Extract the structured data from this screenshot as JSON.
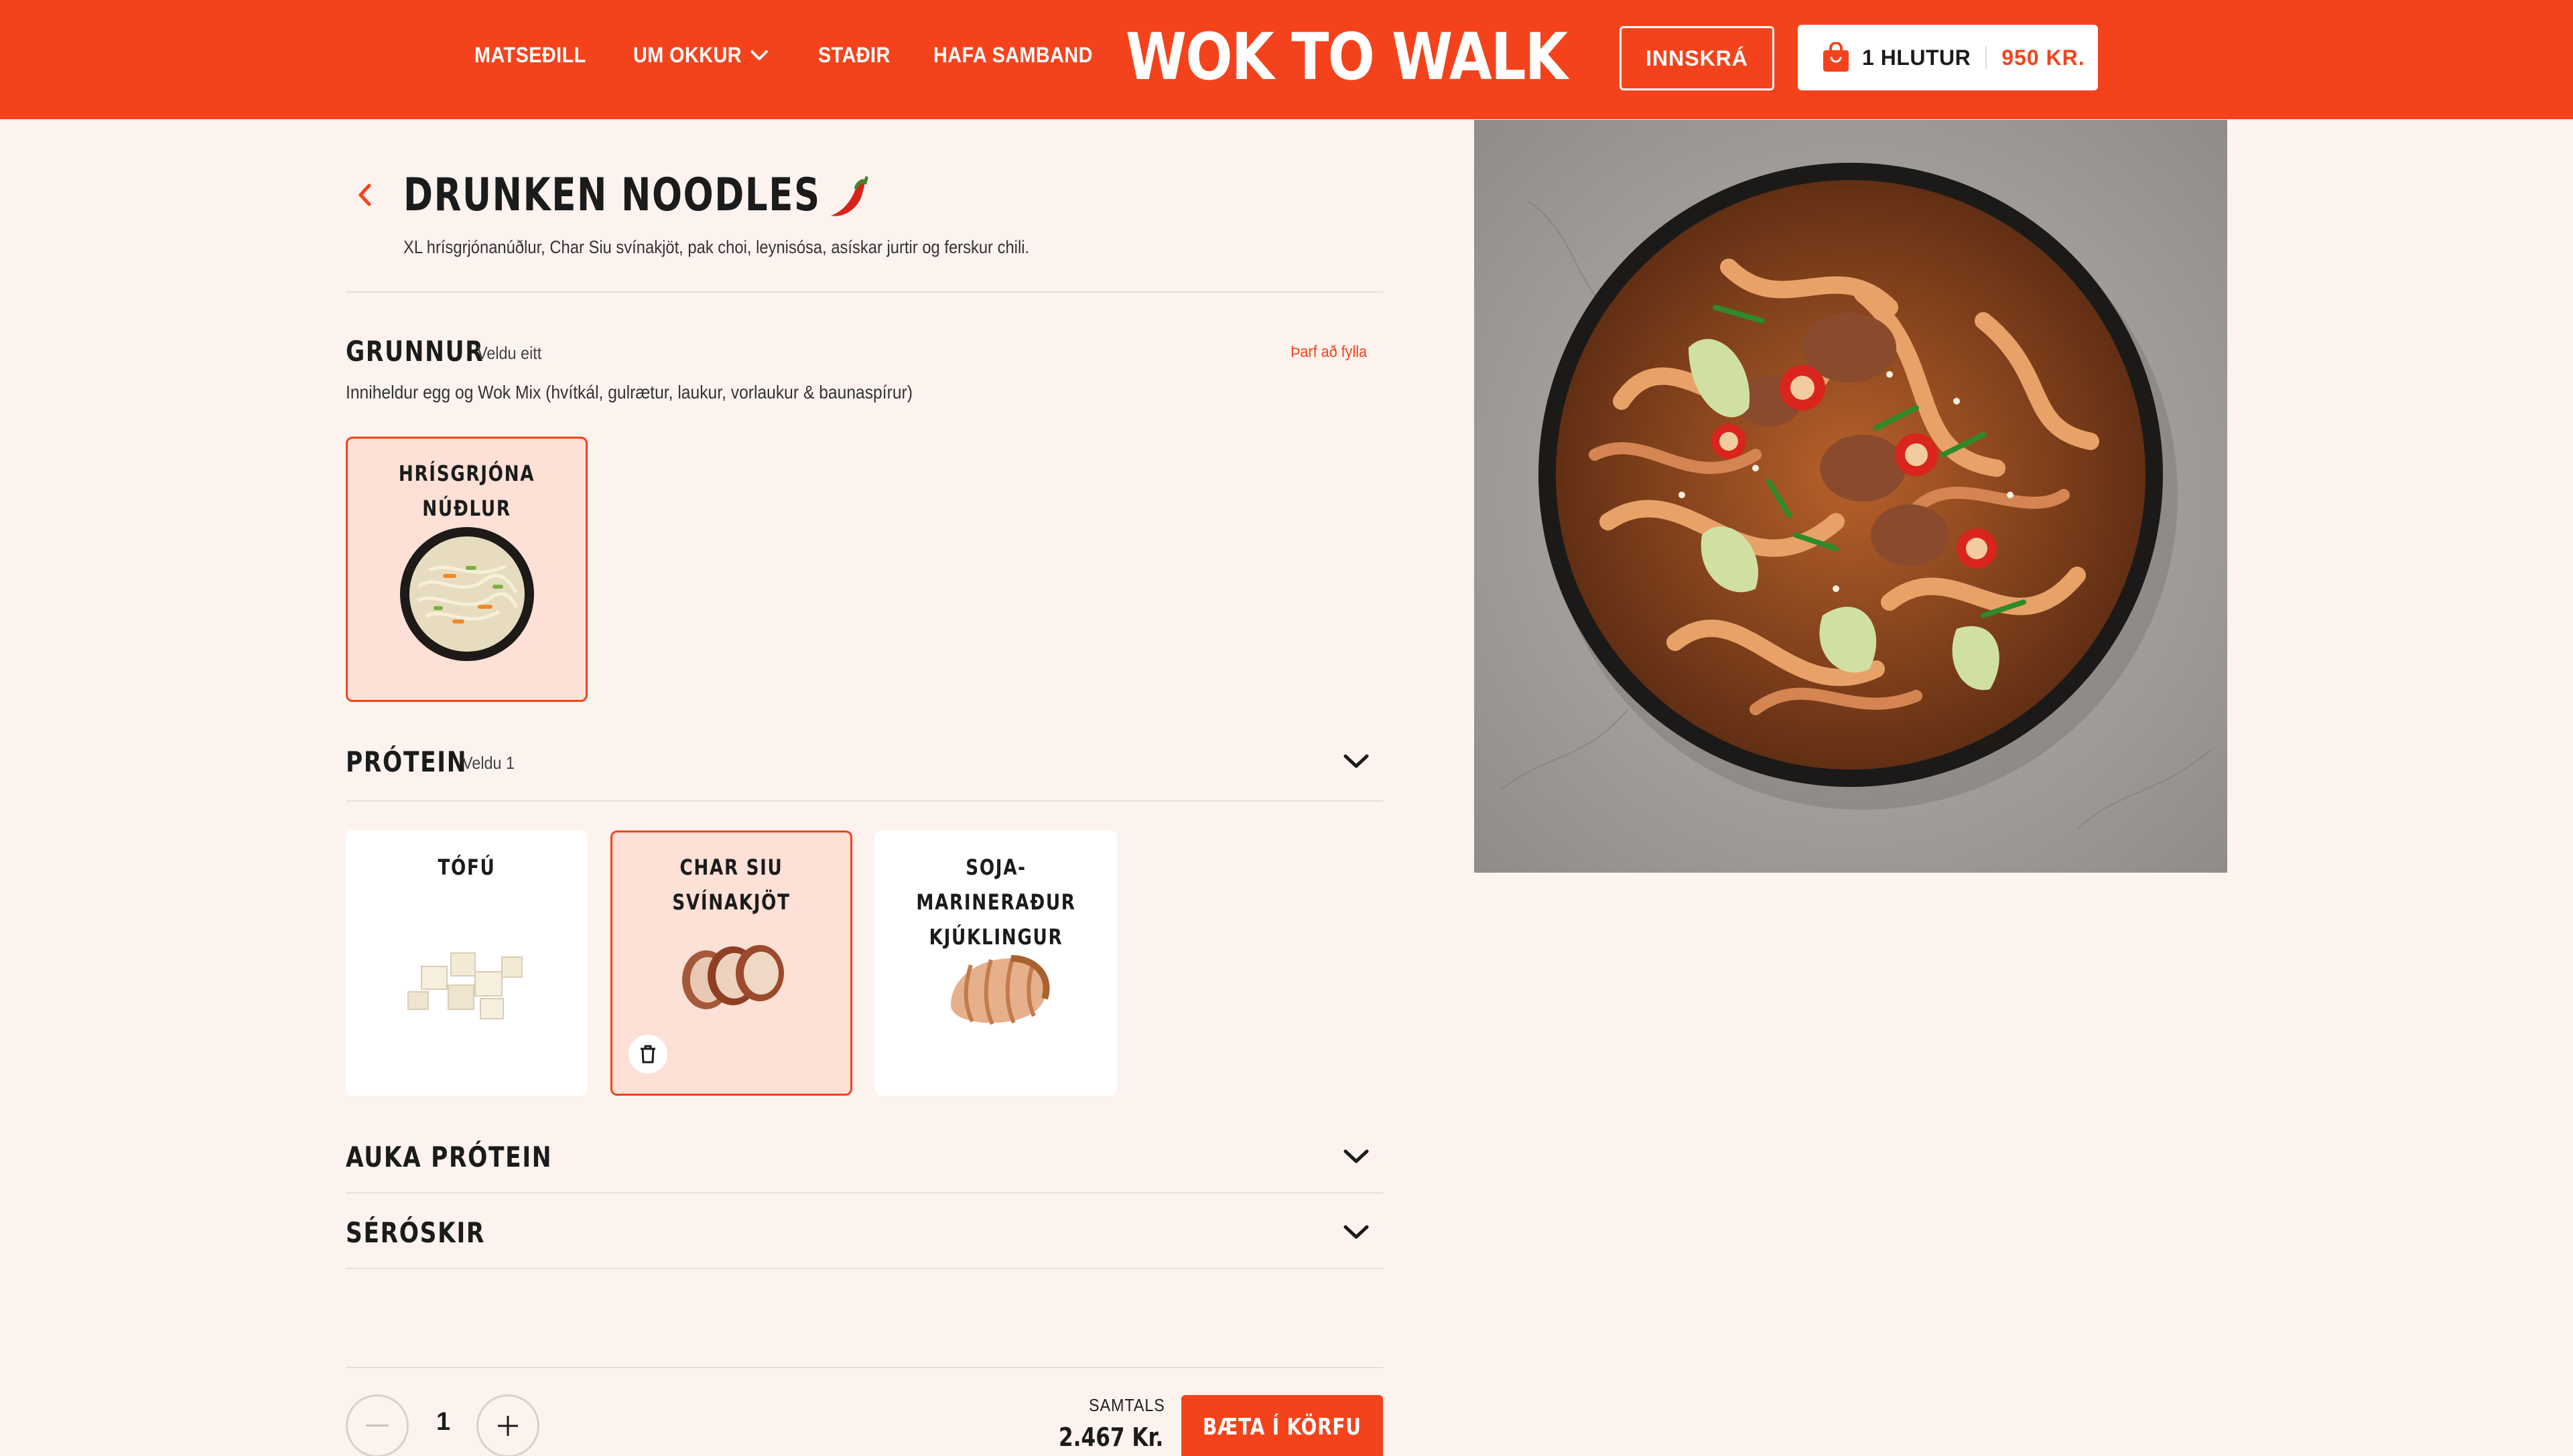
{
  "header": {
    "nav": [
      {
        "label": "MATSEÐILL"
      },
      {
        "label": "UM OKKUR"
      },
      {
        "label": "STAÐIR"
      },
      {
        "label": "HAFA SAMBAND"
      }
    ],
    "logo_text": "WOK TO WALK",
    "login_label": "INNSKRÁ",
    "cart": {
      "count_label": "1 HLUTUR",
      "price": "950 KR."
    }
  },
  "product": {
    "title": "DRUNKEN NOODLES",
    "description": "XL hrísgrjónanúðlur, Char Siu svínakjöt, pak choi, leynisósa, asískar jurtir og ferskur chili."
  },
  "sections": {
    "base": {
      "title": "GRUNNUR",
      "hint": "Veldu eitt",
      "required": "Þarf að fylla",
      "description": "Inniheldur egg og Wok Mix (hvítkál, gulrætur, laukur, vorlaukur & baunaspírur)",
      "options": [
        {
          "label": "HRÍSGRJÓNA\nNÚÐLUR",
          "selected": true
        }
      ]
    },
    "protein": {
      "title": "PRÓTEIN",
      "hint": "Veldu 1",
      "options": [
        {
          "label": "TÓFÚ",
          "selected": false
        },
        {
          "label": "CHAR SIU SVÍNAKJÖT",
          "selected": true
        },
        {
          "label": "SOJA-MARINERAÐUR\nKJÚKLINGUR",
          "selected": false
        }
      ]
    },
    "extra_protein": {
      "title": "AUKA PRÓTEIN"
    },
    "special": {
      "title": "SÉRÓSKIR"
    }
  },
  "footer": {
    "quantity": "1",
    "total_label": "SAMTALS",
    "total_value": "2.467 Kr.",
    "add_label": "BÆTA Í KÖRFU"
  },
  "colors": {
    "brand": "#f4431c",
    "background": "#fcf3ee",
    "selected_card": "#fde0d6"
  }
}
